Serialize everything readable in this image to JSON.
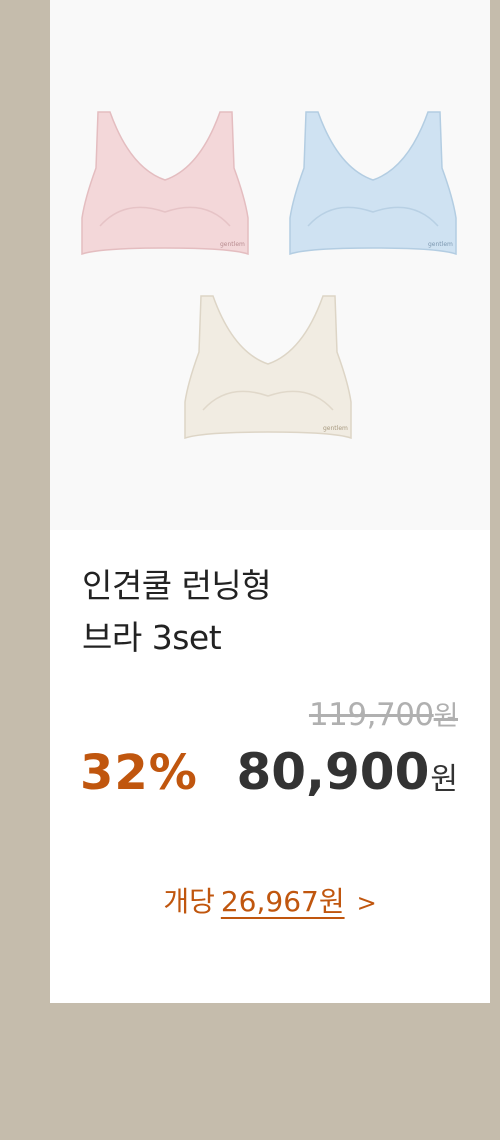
{
  "product": {
    "title_line1": "인견쿨 런닝형",
    "title_line2": "브라 3set",
    "images": [
      {
        "name": "pink-bra-image",
        "color": "#f3d7d9"
      },
      {
        "name": "blue-bra-image",
        "color": "#cfe2f2"
      },
      {
        "name": "ivory-bra-image",
        "color": "#f1ece2"
      }
    ]
  },
  "price": {
    "original": "119,700",
    "original_unit": "원",
    "discount_rate": "32%",
    "sale": "80,900",
    "sale_unit": "원"
  },
  "per_item": {
    "label": "개당",
    "amount": "26,967원",
    "chevron": ">"
  },
  "colors": {
    "accent": "#c0560e",
    "background": "#c5bcac",
    "card": "#ffffff"
  }
}
